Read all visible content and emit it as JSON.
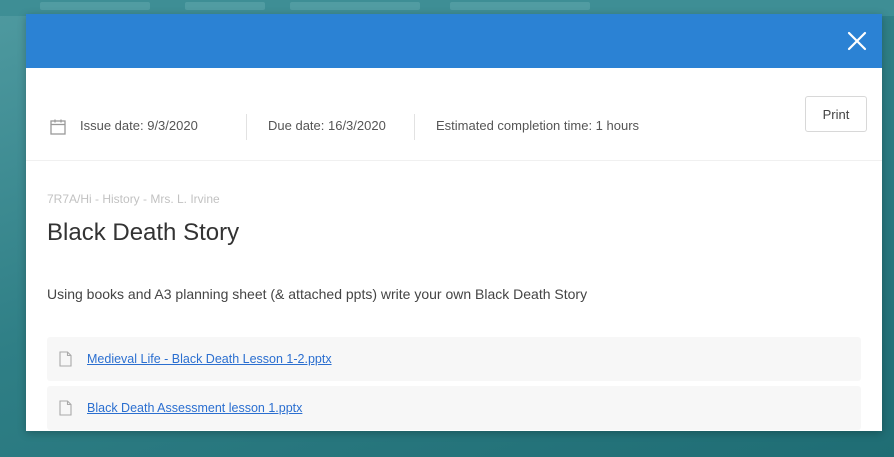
{
  "modal": {
    "info": {
      "issue_date": "Issue date: 9/3/2020",
      "due_date": "Due date: 16/3/2020",
      "estimated_time": "Estimated completion time: 1 hours",
      "print_label": "Print"
    },
    "breadcrumb": "7R7A/Hi - History - Mrs. L. Irvine",
    "title": "Black Death Story",
    "description": "Using books and A3 planning sheet (& attached ppts) write your own Black Death Story",
    "attachments": [
      {
        "name": "Medieval Life - Black Death Lesson 1-2.pptx",
        "icon": "file-icon"
      },
      {
        "name": "Black Death Assessment lesson 1.pptx",
        "icon": "file-icon"
      }
    ]
  },
  "colors": {
    "header": "#2b82d4",
    "background": "#2f7f86",
    "link": "#2b6fd0"
  },
  "icons": {
    "close": "close-icon",
    "calendar": "calendar-icon"
  }
}
